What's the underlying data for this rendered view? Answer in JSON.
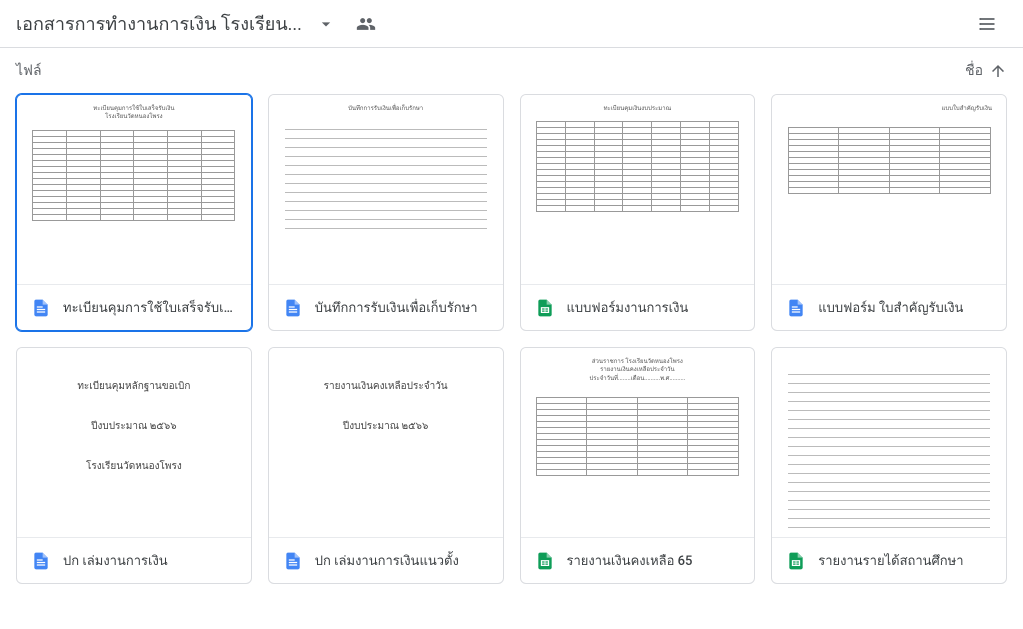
{
  "header": {
    "title": "เอกสารการทำงานการเงิน โรงเรียน..."
  },
  "toolbar": {
    "section_label": "ไฟล์",
    "sort_label": "ชื่อ"
  },
  "files": [
    {
      "name": "ทะเบียนคุมการใช้ใบเสร็จรับเงิน",
      "type": "docs",
      "selected": true,
      "thumb": "table1"
    },
    {
      "name": "บันทึกการรับเงินเพื่อเก็บรักษา",
      "type": "docs",
      "selected": false,
      "thumb": "lines1"
    },
    {
      "name": "แบบฟอร์มงานการเงิน",
      "type": "sheets",
      "selected": false,
      "thumb": "table2"
    },
    {
      "name": "แบบฟอร์ม ใบสำคัญรับเงิน",
      "type": "docs",
      "selected": false,
      "thumb": "table3"
    },
    {
      "name": "ปก เล่มงานการเงิน",
      "type": "docs",
      "selected": false,
      "thumb": "cover1"
    },
    {
      "name": "ปก เล่มงานการเงินแนวตั้ง",
      "type": "docs",
      "selected": false,
      "thumb": "cover2"
    },
    {
      "name": "รายงานเงินคงเหลือ 65",
      "type": "sheets",
      "selected": false,
      "thumb": "table4"
    },
    {
      "name": "รายงานรายได้สถานศึกษา",
      "type": "sheets",
      "selected": false,
      "thumb": "lines2"
    }
  ],
  "thumb_text": {
    "cover1_line1": "ทะเบียนคุมหลักฐานขอเบิก",
    "cover1_line2": "ปีงบประมาณ ๒๕๖๖",
    "cover1_line3": "โรงเรียนวัดหนองโพรง",
    "cover2_line1": "รายงานเงินคงเหลือประจำวัน",
    "cover2_line2": "ปีงบประมาณ ๒๕๖๖",
    "table1_hdr": "ทะเบียนคุมการใช้ใบเสร็จรับเงิน<br>โรงเรียนวัดหนองโพรง",
    "lines1_hdr": "บันทึกการรับเงินเพื่อเก็บรักษา",
    "table2_hdr": "ทะเบียนคุมเงินงบประมาณ",
    "table3_hdr": "แบบใบสำคัญรับเงิน",
    "table4_hdr": "ส่วนราชการ โรงเรียนวัดหนองโพรง<br>รายงานเงินคงเหลือประจำวัน<br>ประจำวันที่........เดือน..........พ.ศ.........."
  }
}
